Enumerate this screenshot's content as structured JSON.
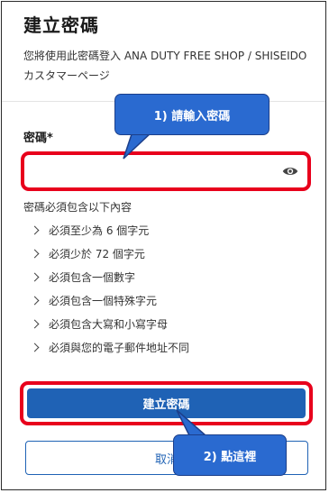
{
  "page": {
    "title": "建立密碼",
    "subtitle": "您將使用此密碼登入 ANA DUTY FREE SHOP / SHISEIDO カスタマーページ"
  },
  "password": {
    "label": "密碼*",
    "value": "",
    "placeholder": "",
    "toggle_icon": "eye-icon"
  },
  "requirements": {
    "title": "密碼必須包含以下內容",
    "items": [
      "必須至少為 6 個字元",
      "必須少於 72 個字元",
      "必須包含一個數字",
      "必須包含一個特殊字元",
      "必須包含大寫和小寫字母",
      "必須與您的電子郵件地址不同"
    ]
  },
  "actions": {
    "create_label": "建立密碼",
    "cancel_label": "取消"
  },
  "callouts": {
    "step1": "1) 請輸入密碼",
    "step2": "2) 點這裡"
  },
  "colors": {
    "primary": "#1f62b5",
    "highlight": "#e8001c",
    "callout": "#2a6ad0"
  }
}
